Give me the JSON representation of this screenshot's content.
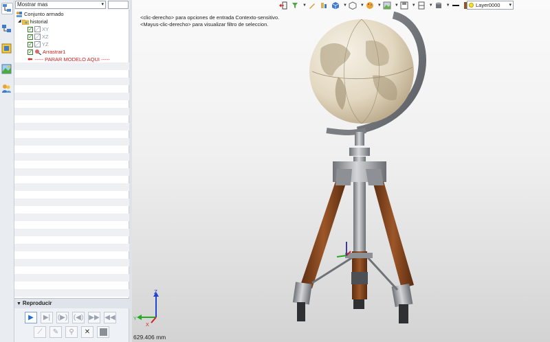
{
  "left_strip": {
    "icons": [
      "model-tree-icon",
      "assembly-icon",
      "part-icon",
      "image-icon",
      "users-icon"
    ]
  },
  "tree": {
    "filter_value": "Mostrar mas",
    "filter_box_value": "",
    "nodes": [
      {
        "label": "Conjunto armado",
        "icon": "assembly-icon"
      },
      {
        "label": "historial",
        "icon": "folder-icon"
      },
      {
        "label": "XY",
        "icon": "plane-icon"
      },
      {
        "label": "XZ",
        "icon": "plane-icon"
      },
      {
        "label": "YZ",
        "icon": "plane-icon"
      },
      {
        "label": "Arrastrar1",
        "icon": "drag-icon"
      },
      {
        "label": "----- PARAR MODELO AQUI -----",
        "icon": "arrow-left-icon"
      }
    ]
  },
  "playback": {
    "title": "Reproducir",
    "buttons_row1": [
      "play-icon",
      "step-forward-icon",
      "fast-forward-icon",
      "step-back-icon",
      "skip-forward-icon",
      "rewind-icon"
    ],
    "buttons_row2": [
      "constraint-icon",
      "edit-icon",
      "run-icon",
      "delete-icon",
      "stop-icon"
    ]
  },
  "viewport": {
    "hint_line1": "<clic-derecho> para opciones de entrada Contexto-sensitivo.",
    "hint_line2": "<Mayus-clic-derecho> para visualizar filtro de seleccion.",
    "measure": "629.406 mm",
    "layer": "Layer0000",
    "axis_labels": {
      "x": "X",
      "y": "Y",
      "z": "Z"
    }
  },
  "colors": {
    "accent": "#1f6fd0",
    "stop_marker": "#d02020",
    "wood": "#8a4a22",
    "metal": "#9a9da2",
    "background_top": "#fafafa",
    "background_bottom": "#d3d3d3"
  }
}
